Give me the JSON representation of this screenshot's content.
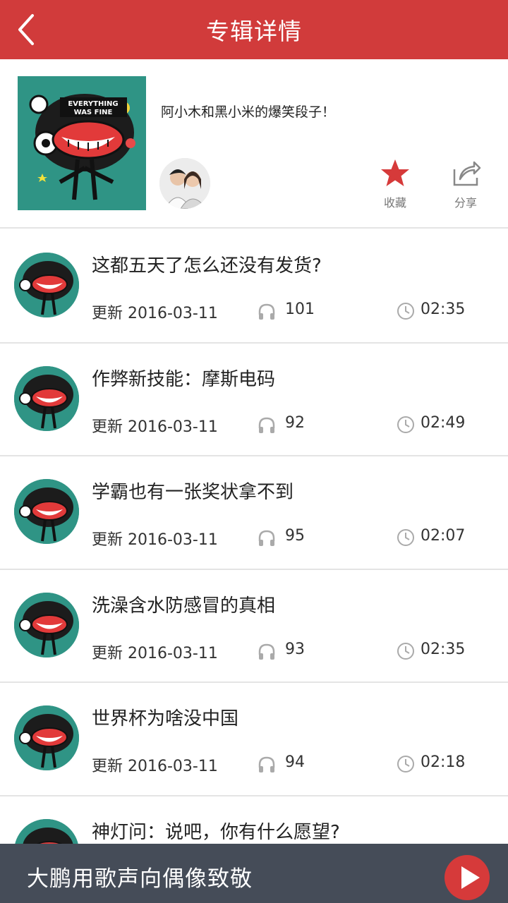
{
  "header": {
    "title": "专辑详情",
    "back_icon": "chevron-left-icon"
  },
  "album": {
    "cover_text_line1": "EVERYTHING",
    "cover_text_line2": "WAS FINE",
    "description": "阿小木和黑小米的爆笑段子！",
    "favorite_label": "收藏",
    "share_label": "分享",
    "favorite_icon": "star-icon",
    "share_icon": "share-icon",
    "accent_color": "#d13b3b"
  },
  "tracks": [
    {
      "title": "这都五天了怎么还没有发货?",
      "date": "更新 2016-03-11",
      "plays": "101",
      "duration": "02:35"
    },
    {
      "title": "作弊新技能：摩斯电码",
      "date": "更新 2016-03-11",
      "plays": "92",
      "duration": "02:49"
    },
    {
      "title": "学霸也有一张奖状拿不到",
      "date": "更新 2016-03-11",
      "plays": "95",
      "duration": "02:07"
    },
    {
      "title": "洗澡含水防感冒的真相",
      "date": "更新 2016-03-11",
      "plays": "93",
      "duration": "02:35"
    },
    {
      "title": "世界杯为啥没中国",
      "date": "更新 2016-03-11",
      "plays": "94",
      "duration": "02:18"
    },
    {
      "title": "神灯问：说吧，你有什么愿望?"
    }
  ],
  "player": {
    "now_playing": "大鹏用歌声向偶像致敬",
    "play_icon": "play-icon"
  }
}
